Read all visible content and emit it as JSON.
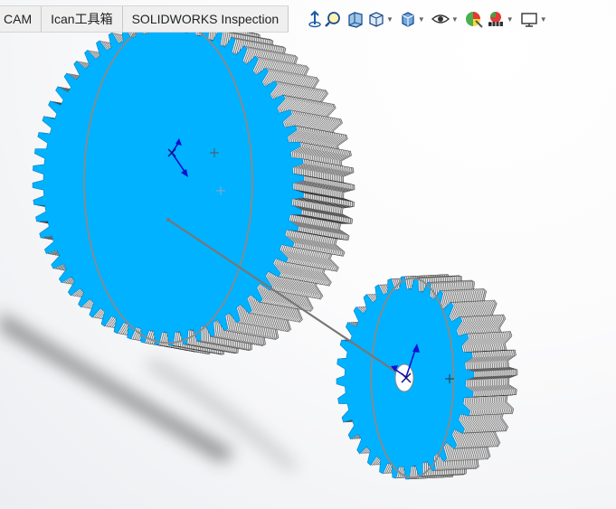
{
  "command_tabs": [
    {
      "label": "CAM"
    },
    {
      "label": "Ican工具箱"
    },
    {
      "label": "SOLIDWORKS Inspection"
    }
  ],
  "view_toolbar": {
    "icons": [
      "view-orientation-icon",
      "zoom-to-area-icon",
      "section-view-icon",
      "display-style-icon",
      "view-cube-icon",
      "hide-show-items-icon",
      "edit-appearance-icon",
      "apply-scene-icon",
      "view-settings-icon"
    ]
  },
  "graphics_area": {
    "large_gear": {
      "color": "#00b2ff",
      "teeth": 60
    },
    "small_gear": {
      "color": "#00b2ff",
      "teeth": 32
    }
  },
  "colors": {
    "gear_face": "#00b2ff",
    "gear_side": "#d9d9d9",
    "axis": "#1010d0",
    "center_line": "#777777"
  }
}
